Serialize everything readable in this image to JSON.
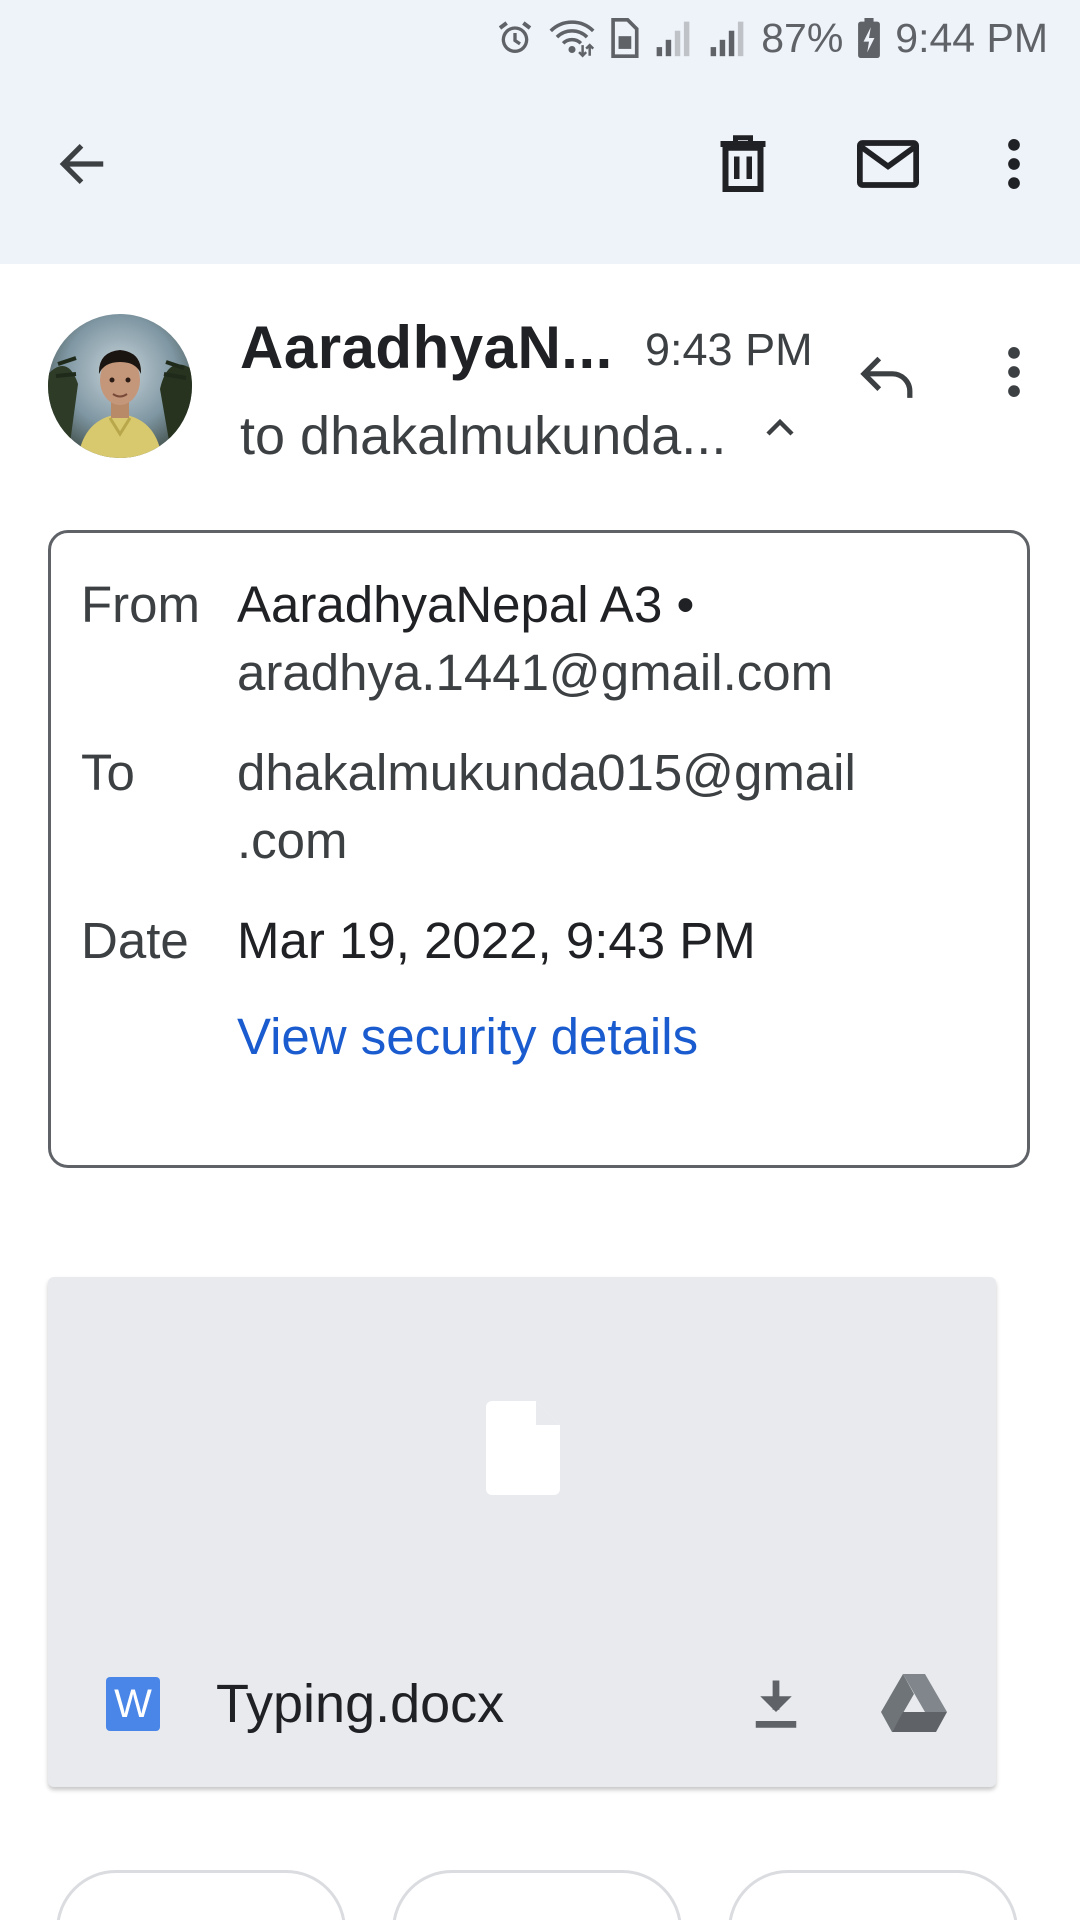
{
  "status_bar": {
    "battery": "87%",
    "time": "9:44 PM",
    "icons": [
      "alarm-icon",
      "wifi-icon",
      "sim-icon",
      "signal-icon",
      "signal-icon",
      "battery-charging-icon"
    ]
  },
  "app_bar": {
    "icons": [
      "back-arrow-icon",
      "delete-icon",
      "mark-unread-icon",
      "more-vert-icon"
    ]
  },
  "message": {
    "sender_name": "AaradhyaN...",
    "time": "9:43 PM",
    "recipient_line": "to dhakalmukunda...",
    "icons": [
      "chevron-up-icon",
      "reply-icon",
      "more-vert-icon"
    ]
  },
  "details": {
    "from_label": "From",
    "from_name": "AaradhyaNepal A3 •",
    "from_email": "aradhya.1441@gmail.com",
    "to_label": "To",
    "to_email_line1": "dhakalmukunda015@gmail",
    "to_email_line2": ".com",
    "date_label": "Date",
    "date_value": "Mar 19, 2022, 9:43 PM",
    "security_link": "View security details"
  },
  "attachment": {
    "file_name": "Typing.docx",
    "file_type_letter": "W",
    "icons": [
      "document-icon",
      "word-file-icon",
      "download-icon",
      "google-drive-icon"
    ]
  },
  "colors": {
    "top_band": "#eef2f9",
    "link": "#1a5ccf",
    "attachment_bg": "#e8eaed",
    "word_blue": "#4a86e8"
  }
}
